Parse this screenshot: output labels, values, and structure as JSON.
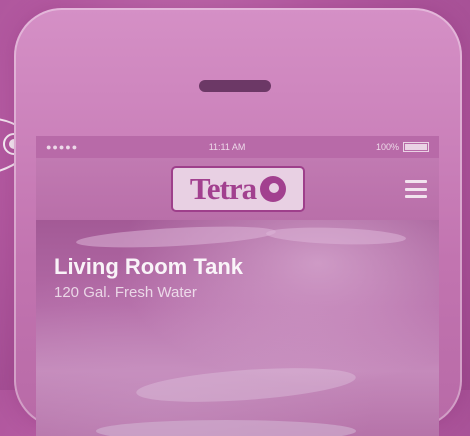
{
  "status_bar": {
    "signal": "●●●●●",
    "time": "11:11 AM",
    "battery_percent": "100%"
  },
  "brand": {
    "logo_text": "Tetra"
  },
  "tank": {
    "name": "Living Room Tank",
    "details": "120 Gal. Fresh Water"
  },
  "colors": {
    "background": "#b45aa1",
    "logo_red": "#a2408f"
  }
}
